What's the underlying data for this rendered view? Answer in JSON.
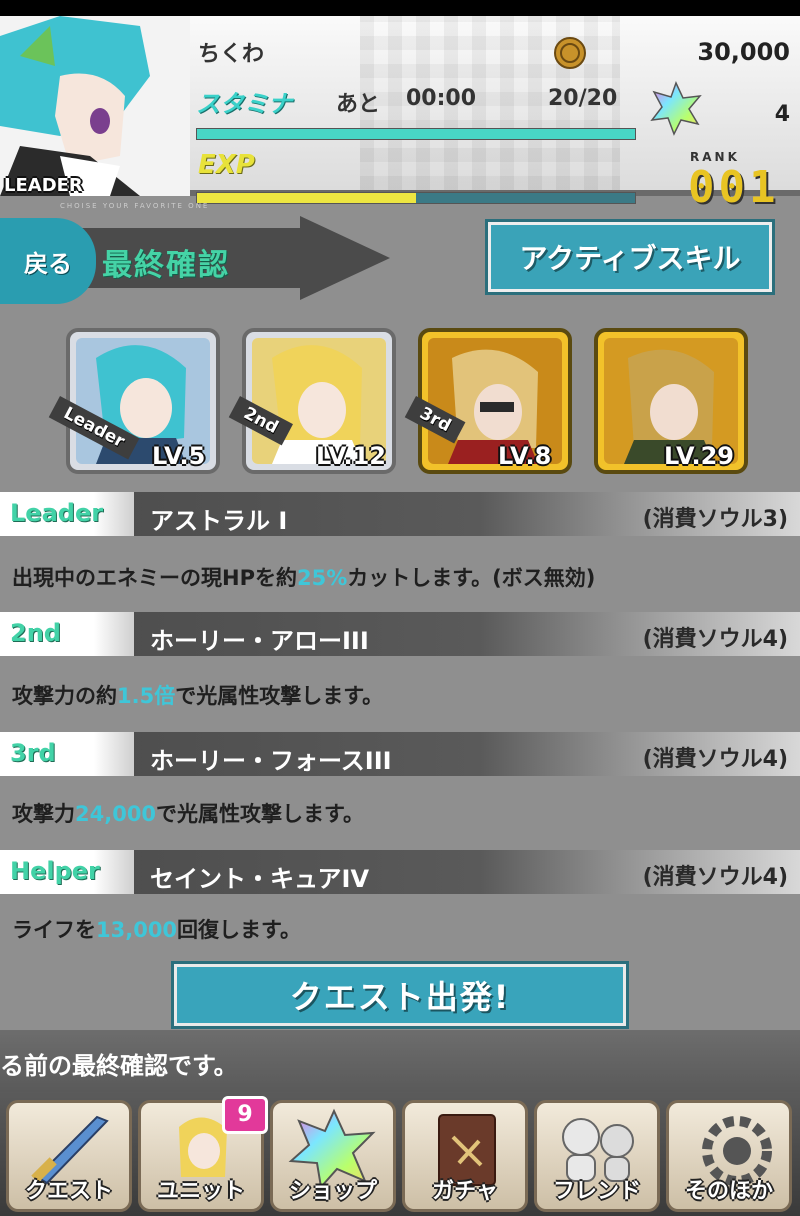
{
  "header": {
    "leader_label": "LEADER",
    "player_name": "ちくわ",
    "coins": "30,000",
    "stamina_label": "スタミナ",
    "stamina_remaining_label": "あと",
    "stamina_timer": "00:00",
    "stamina_value": "20/20",
    "stamina_fill": 1.0,
    "gems": "4",
    "exp_label": "EXP",
    "exp_fill": 0.5,
    "rank_caption": "RANK",
    "rank_value": "001"
  },
  "nav": {
    "back_label": "戻る",
    "page_title": "最終確認",
    "tagline": "CHOISE YOUR FAVORITE ONE",
    "active_skill_label": "アクティブスキル"
  },
  "units": [
    {
      "badge": "Leader",
      "level": "LV.5",
      "frame": "silver"
    },
    {
      "badge": "2nd",
      "level": "LV.12",
      "frame": "silver"
    },
    {
      "badge": "3rd",
      "level": "LV.8",
      "frame": "gold"
    },
    {
      "badge": "",
      "level": "LV.29",
      "frame": "gold"
    }
  ],
  "skills": [
    {
      "tag": "Leader",
      "name": "アストラル I",
      "cost": "(消費ソウル3)",
      "desc_pre": "出現中のエネミーの現HPを約",
      "desc_hl": "25%",
      "desc_post": "カットします。(ボス無効)"
    },
    {
      "tag": "2nd",
      "name": "ホーリー・アローIII",
      "cost": "(消費ソウル4)",
      "desc_pre": "攻撃力の約",
      "desc_hl": "1.5倍",
      "desc_post": "で光属性攻撃します。"
    },
    {
      "tag": "3rd",
      "name": "ホーリー・フォースIII",
      "cost": "(消費ソウル4)",
      "desc_pre": "攻撃力",
      "desc_hl": "24,000",
      "desc_post": "で光属性攻撃します。"
    },
    {
      "tag": "Helper",
      "name": "セイント・キュアIV",
      "cost": "(消費ソウル4)",
      "desc_pre": "ライフを",
      "desc_hl": "13,000",
      "desc_post": "回復します。"
    }
  ],
  "quest_start_label": "クエスト出発!",
  "message": "る前の最終確認です。",
  "bottom_nav": [
    {
      "label": "クエスト",
      "icon": "sword-icon"
    },
    {
      "label": "ユニット",
      "icon": "unit-icon"
    },
    {
      "label": "ショップ",
      "icon": "gem-icon"
    },
    {
      "label": "ガチャ",
      "icon": "book-icon"
    },
    {
      "label": "フレンド",
      "icon": "friends-icon"
    },
    {
      "label": "そのほか",
      "icon": "gear-icon"
    }
  ],
  "unit_badge_count": "9",
  "colors": {
    "accent_teal": "#3aa3b8",
    "skill_tag_green": "#42d2a7",
    "highlight_cyan": "#3fc6d8",
    "exp_yellow": "#ede641",
    "badge_pink": "#e2399a"
  }
}
